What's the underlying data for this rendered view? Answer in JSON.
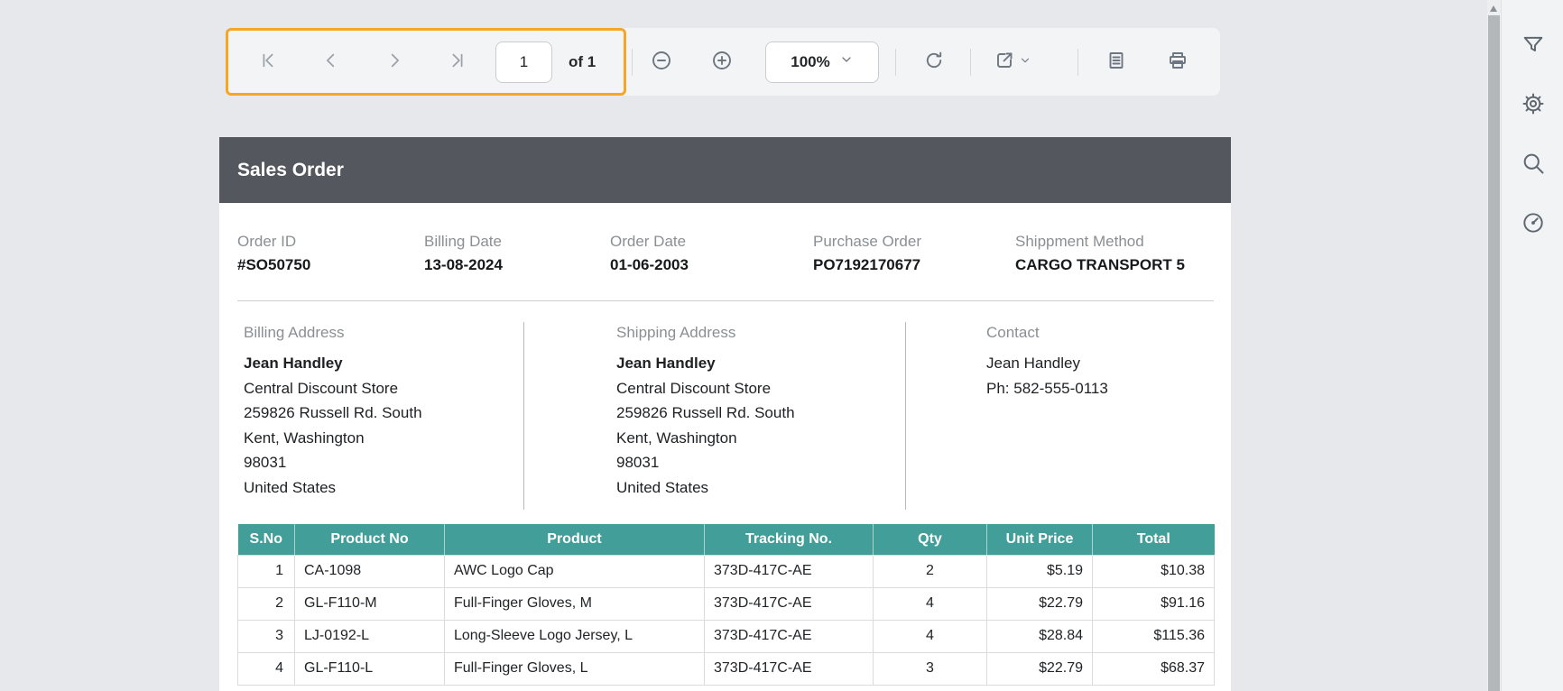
{
  "toolbar": {
    "page_number": "1",
    "page_count_label": "of 1",
    "zoom_level": "100%",
    "icons": [
      "first-page-icon",
      "previous-page-icon",
      "next-page-icon",
      "last-page-icon",
      "zoom-out-icon",
      "zoom-in-icon",
      "chevron-down-icon",
      "refresh-icon",
      "export-icon",
      "print-layout-icon",
      "print-icon"
    ]
  },
  "side_panel": {
    "icons": [
      "filter-icon",
      "gear-icon",
      "search-icon",
      "performance-gauge-icon"
    ]
  },
  "document": {
    "title": "Sales Order",
    "meta": [
      {
        "label": "Order ID",
        "value": "#SO50750"
      },
      {
        "label": "Billing Date",
        "value": "13-08-2024"
      },
      {
        "label": "Order Date",
        "value": "01-06-2003"
      },
      {
        "label": "Purchase Order",
        "value": "PO7192170677"
      },
      {
        "label": "Shippment Method",
        "value": "CARGO TRANSPORT 5"
      }
    ],
    "billing_address": {
      "label": "Billing Address",
      "name": "Jean Handley",
      "lines": [
        "Central Discount Store",
        "259826 Russell Rd. South",
        "Kent, Washington",
        "98031",
        "United States"
      ]
    },
    "shipping_address": {
      "label": "Shipping Address",
      "name": "Jean Handley",
      "lines": [
        "Central Discount Store",
        "259826 Russell Rd. South",
        "Kent, Washington",
        "98031",
        "United States"
      ]
    },
    "contact": {
      "label": "Contact",
      "lines": [
        "Jean Handley",
        "Ph: 582-555-0113"
      ]
    },
    "table": {
      "columns": [
        "S.No",
        "Product No",
        "Product",
        "Tracking No.",
        "Qty",
        "Unit Price",
        "Total"
      ],
      "rows": [
        [
          "1",
          "CA-1098",
          "AWC Logo Cap",
          "373D-417C-AE",
          "2",
          "$5.19",
          "$10.38"
        ],
        [
          "2",
          "GL-F110-M",
          "Full-Finger Gloves, M",
          "373D-417C-AE",
          "4",
          "$22.79",
          "$91.16"
        ],
        [
          "3",
          "LJ-0192-L",
          "Long-Sleeve Logo Jersey, L",
          "373D-417C-AE",
          "4",
          "$28.84",
          "$115.36"
        ],
        [
          "4",
          "GL-F110-L",
          "Full-Finger Gloves, L",
          "373D-417C-AE",
          "3",
          "$22.79",
          "$68.37"
        ]
      ]
    }
  },
  "colors": {
    "accent_orange": "#f6a623",
    "header_dark": "#54585e",
    "table_header_teal": "#429e98",
    "background": "#e6e8eb",
    "toolbar_background": "#f3f4f6",
    "label_gray": "#8a8f94"
  }
}
